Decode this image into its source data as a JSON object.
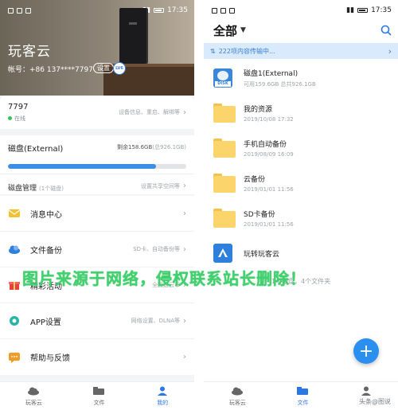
{
  "left": {
    "status_time": "17:35",
    "hero": {
      "title": "玩客云",
      "account": "帐号：+86 137****7797",
      "tag": "设置",
      "badge": "LV6"
    },
    "device": {
      "name": "7797",
      "status": "在线",
      "hint": "设备信息、重启、解绑等"
    },
    "disk": {
      "title": "磁盘(External)",
      "remaining": "剩余158.6GB",
      "total": "(总926.1GB)",
      "used_fraction": 0.83,
      "manage_title": "磁盘管理",
      "manage_sub": "(1个磁盘)",
      "manage_hint": "设置共享空间等"
    },
    "menu": [
      {
        "label": "消息中心",
        "hint": "",
        "icon": "mail-icon",
        "color": "#f5c02f"
      },
      {
        "label": "文件备份",
        "hint": "SD卡、自动备份等",
        "icon": "cloud-icon",
        "color": "#2f7fdc"
      },
      {
        "label": "精彩活动",
        "hint": "全民送云币",
        "icon": "gift-icon",
        "color": "#e8433a"
      },
      {
        "label": "APP设置",
        "hint": "网络设置、DLNA等",
        "icon": "gear-icon",
        "color": "#27b5a7"
      },
      {
        "label": "帮助与反馈",
        "hint": "",
        "icon": "chat-icon",
        "color": "#f29b24"
      }
    ],
    "tabs": [
      {
        "label": "玩客云",
        "icon": "cloud-tab-icon",
        "active": false
      },
      {
        "label": "文件",
        "icon": "folder-tab-icon",
        "active": false
      },
      {
        "label": "我的",
        "icon": "person-tab-icon",
        "active": true
      }
    ]
  },
  "right": {
    "status_time": "17:35",
    "title": "全部",
    "transfer_text": "222项内容传输中...",
    "files": [
      {
        "name": "磁盘1(External)",
        "meta": "可用159.6GB 总共926.1GB",
        "type": "disk"
      },
      {
        "name": "我的资源",
        "meta": "2019/10/08 17:32",
        "type": "folder"
      },
      {
        "name": "手机自动备份",
        "meta": "2019/08/09 16:09",
        "type": "folder"
      },
      {
        "name": "云备份",
        "meta": "2019/01/01 11:56",
        "type": "folder"
      },
      {
        "name": "SD卡备份",
        "meta": "2019/01/01 11:56",
        "type": "folder"
      },
      {
        "name": "玩转玩客云",
        "meta": "",
        "type": "app"
      }
    ],
    "summary": "1个磁盘，4个文件夹",
    "tabs": [
      {
        "label": "玩客云",
        "icon": "cloud-tab-icon",
        "active": false
      },
      {
        "label": "文件",
        "icon": "folder-tab-icon",
        "active": true
      },
      {
        "label": "我的",
        "icon": "person-tab-icon",
        "active": false
      }
    ]
  },
  "watermark": "图片来源于网络，侵权联系站长删除！",
  "credit": "头条@图说"
}
